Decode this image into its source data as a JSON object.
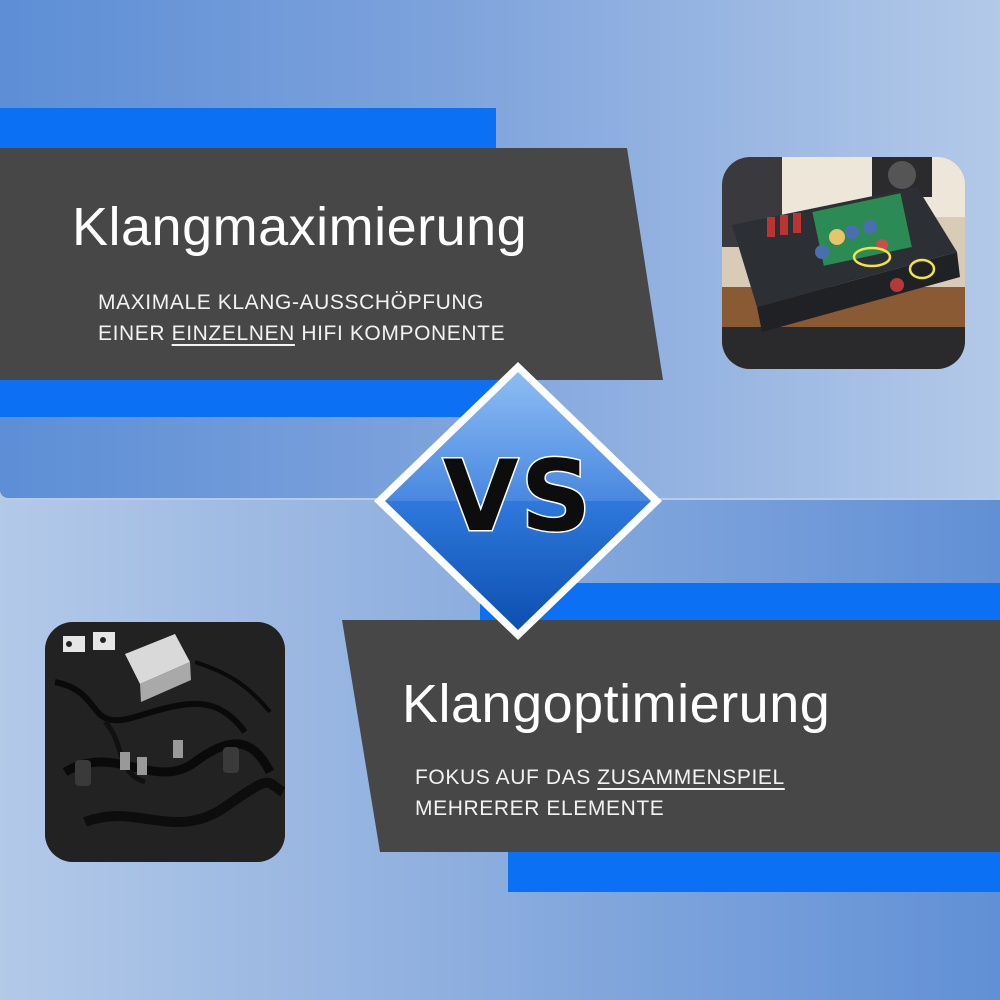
{
  "comparison": {
    "left": {
      "title": "Klangmaximierung",
      "subtitle_line1": "MAXIMALE KLANG-AUSSCHÖPFUNG",
      "subtitle_line2_pre": "EINER ",
      "subtitle_line2_emph": "EINZELNEN",
      "subtitle_line2_post": " HIFI KOMPONENTE",
      "image_label": "amplifier-open-chassis-photo"
    },
    "separator": "VS",
    "right": {
      "title": "Klangoptimierung",
      "subtitle_line1_pre": "FOKUS AUF DAS ",
      "subtitle_line1_emph": "ZUSAMMENSPIEL",
      "subtitle_line2": "MEHRERER ELEMENTE",
      "image_label": "cables-and-accessories-photo"
    }
  },
  "colors": {
    "accent_blue": "#0c70f5",
    "panel_gray": "#474747"
  }
}
